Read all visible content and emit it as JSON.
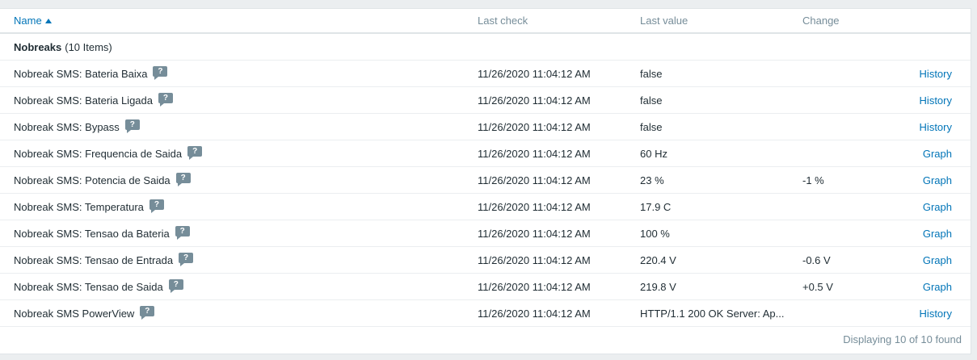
{
  "table": {
    "headers": {
      "name": "Name",
      "last_check": "Last check",
      "last_value": "Last value",
      "change": "Change"
    },
    "group": {
      "name": "Nobreaks",
      "count": "(10 Items)"
    },
    "rows": [
      {
        "name": "Nobreak SMS: Bateria Baixa",
        "last_check": "11/26/2020 11:04:12 AM",
        "last_value": "false",
        "change": "",
        "action": "History"
      },
      {
        "name": "Nobreak SMS: Bateria Ligada",
        "last_check": "11/26/2020 11:04:12 AM",
        "last_value": "false",
        "change": "",
        "action": "History"
      },
      {
        "name": "Nobreak SMS: Bypass",
        "last_check": "11/26/2020 11:04:12 AM",
        "last_value": "false",
        "change": "",
        "action": "History"
      },
      {
        "name": "Nobreak SMS: Frequencia de Saida",
        "last_check": "11/26/2020 11:04:12 AM",
        "last_value": "60 Hz",
        "change": "",
        "action": "Graph"
      },
      {
        "name": "Nobreak SMS: Potencia de Saida",
        "last_check": "11/26/2020 11:04:12 AM",
        "last_value": "23 %",
        "change": "-1 %",
        "action": "Graph"
      },
      {
        "name": "Nobreak SMS: Temperatura",
        "last_check": "11/26/2020 11:04:12 AM",
        "last_value": "17.9 C",
        "change": "",
        "action": "Graph"
      },
      {
        "name": "Nobreak SMS: Tensao da Bateria",
        "last_check": "11/26/2020 11:04:12 AM",
        "last_value": "100 %",
        "change": "",
        "action": "Graph"
      },
      {
        "name": "Nobreak SMS: Tensao de Entrada",
        "last_check": "11/26/2020 11:04:12 AM",
        "last_value": "220.4 V",
        "change": "-0.6 V",
        "action": "Graph"
      },
      {
        "name": "Nobreak SMS: Tensao de Saida",
        "last_check": "11/26/2020 11:04:12 AM",
        "last_value": "219.8 V",
        "change": "+0.5 V",
        "action": "Graph"
      },
      {
        "name": "Nobreak SMS PowerView",
        "last_check": "11/26/2020 11:04:12 AM",
        "last_value": "HTTP/1.1 200 OK Server: Ap...",
        "change": "",
        "action": "History"
      }
    ],
    "hint_glyph": "?",
    "footer": "Displaying 10 of 10 found"
  },
  "colors": {
    "link": "#0275b8",
    "muted": "#768d99",
    "text": "#1f2c33",
    "background": "#ebeef0"
  },
  "icons": {
    "sort": "sort-ascending-icon",
    "hint": "help-hint-icon"
  }
}
